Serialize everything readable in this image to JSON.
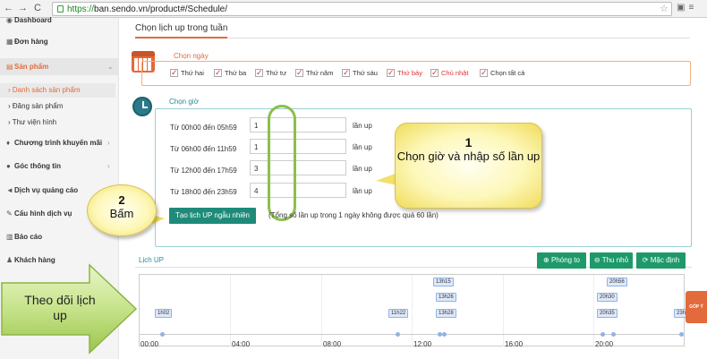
{
  "browser": {
    "url_https": "https://",
    "url_rest": "ban.sendo.vn/product#/Schedule/"
  },
  "sidebar": {
    "items": [
      {
        "label": "Dashboard"
      },
      {
        "label": "Đơn hàng"
      },
      {
        "label": "Sản phẩm"
      },
      {
        "label": "Chương trình khuyến mãi"
      },
      {
        "label": "Góc thông tin"
      },
      {
        "label": "Dịch vụ quảng cáo"
      },
      {
        "label": "Cấu hình dịch vụ"
      },
      {
        "label": "Báo cáo"
      },
      {
        "label": "Khách hàng"
      }
    ],
    "subitems": [
      {
        "label": "› Danh sách sản phẩm"
      },
      {
        "label": "› Đăng sản phẩm"
      },
      {
        "label": "› Thư viện hình"
      }
    ]
  },
  "schedule": {
    "title": "Chọn lịch up trong tuần",
    "day_section_label": "Chọn ngày",
    "days": [
      "Thứ hai",
      "Thứ ba",
      "Thứ tư",
      "Thứ năm",
      "Thứ sáu",
      "Thứ bảy",
      "Chủ nhật",
      "Chọn tất cả"
    ],
    "time_section_label": "Chọn giờ",
    "rows": [
      {
        "label": "Từ 00h00 đến 05h59",
        "value": "1",
        "unit": "lần up"
      },
      {
        "label": "Từ 06h00 đến 11h59",
        "value": "1",
        "unit": "lần up"
      },
      {
        "label": "Từ 12h00 đến 17h59",
        "value": "3",
        "unit": "lần up"
      },
      {
        "label": "Từ 18h00 đến 23h59",
        "value": "4",
        "unit": "lần up"
      }
    ],
    "random_button": "Tạo lịch UP ngẫu nhiên",
    "note": "(Tổng số lần up trong 1 ngày không được quá 60 lần)"
  },
  "timeline": {
    "title": "Lịch UP",
    "zoom_in": "Phóng to",
    "zoom_out": "Thu nhỏ",
    "reset": "Mặc định",
    "ticks": [
      "00:00",
      "04:00",
      "08:00",
      "12:00",
      "16:00",
      "20:00"
    ],
    "labels": [
      "1h02",
      "11h22",
      "13h15",
      "13h26",
      "13h28",
      "20h56",
      "20h30",
      "20h35",
      "23h"
    ],
    "feedback": "GÓP Ý"
  },
  "annotations": {
    "callout1_number": "1",
    "callout1_text": "Chọn giờ và nhập số lần up",
    "callout2_number": "2",
    "callout2_text": "Bấm",
    "arrow_text": "Theo dõi lịch up"
  }
}
